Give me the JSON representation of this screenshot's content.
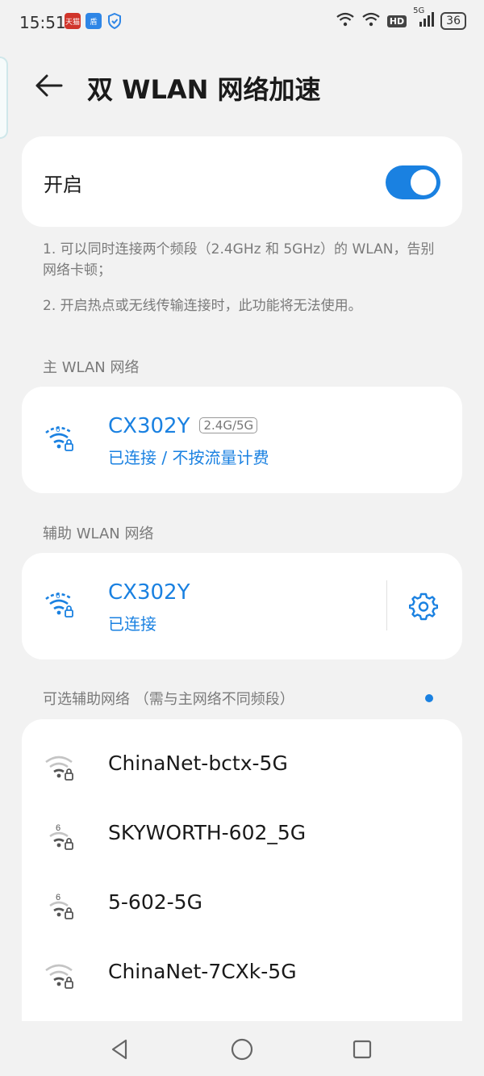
{
  "status_bar": {
    "time": "15:51",
    "app1_text": "天猫",
    "app2_text": "盾",
    "hd": "HD",
    "net_type": "5G",
    "battery": "36"
  },
  "header": {
    "title": "双 WLAN 网络加速",
    "back_icon": "back-arrow-icon"
  },
  "toggle": {
    "label": "开启",
    "on": true,
    "accent": "#1a81e1"
  },
  "descriptions": {
    "line1": "1. 可以同时连接两个频段（2.4GHz 和 5GHz）的 WLAN，告别网络卡顿；",
    "line2": "2. 开启热点或无线传输连接时，此功能将无法使用。"
  },
  "main_wlan": {
    "section_label": "主 WLAN 网络",
    "name": "CX302Y",
    "band": "2.4G/5G",
    "status": "已连接 / 不按流量计费"
  },
  "aux_wlan": {
    "section_label": "辅助 WLAN 网络",
    "name": "CX302Y",
    "status": "已连接"
  },
  "options": {
    "section_label": "可选辅助网络 （需与主网络不同频段）",
    "items": [
      {
        "name": "ChinaNet-bctx-5G",
        "wifi6": false
      },
      {
        "name": "SKYWORTH-602_5G",
        "wifi6": true
      },
      {
        "name": "5-602-5G",
        "wifi6": true
      },
      {
        "name": "ChinaNet-7CXk-5G",
        "wifi6": false
      }
    ]
  }
}
